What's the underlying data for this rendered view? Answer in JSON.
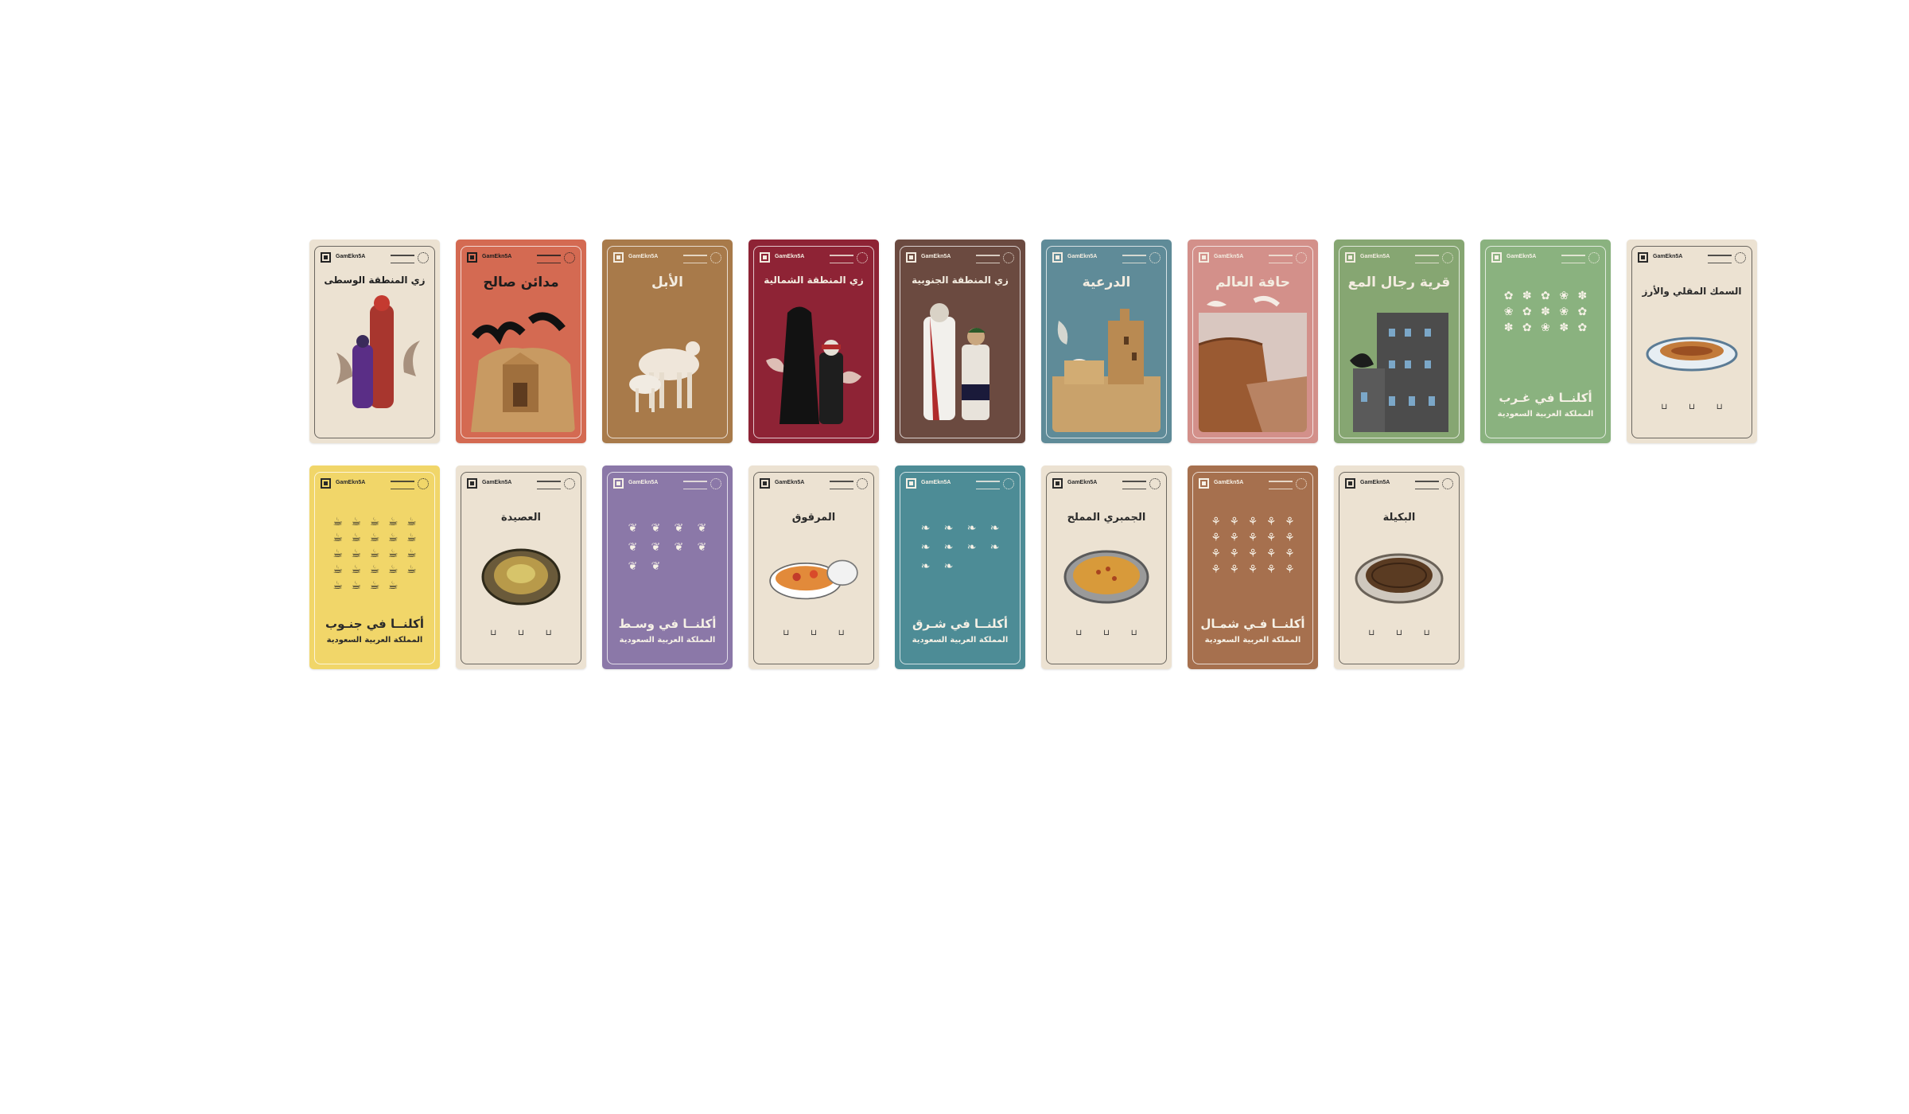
{
  "brand_label": "GamEkn5A",
  "cards": [
    {
      "id": "central-dress",
      "kind": "photo",
      "title": "زي المنطقة الوسطى",
      "bg": "#ece2d2",
      "fg": "#222222",
      "art": "figures-central"
    },
    {
      "id": "madain-saleh",
      "kind": "photo",
      "title": "مدائن صالح",
      "bg": "#d46a52",
      "fg": "#1d1d1d",
      "art": "rock-tomb"
    },
    {
      "id": "camel",
      "kind": "photo",
      "title": "الأبل",
      "bg": "#a87a4a",
      "fg": "#f3ece0",
      "art": "camels"
    },
    {
      "id": "northern-dress",
      "kind": "photo",
      "title": "زي المنطقة الشمالية",
      "bg": "#8e2335",
      "fg": "#f3ece0",
      "art": "figures-north"
    },
    {
      "id": "southern-dress",
      "kind": "photo",
      "title": "زي المنطقة الجنوبية",
      "bg": "#6b4a40",
      "fg": "#f3ece0",
      "art": "figures-south"
    },
    {
      "id": "diriyah",
      "kind": "photo",
      "title": "الدرعية",
      "bg": "#5f8b98",
      "fg": "#f3ece0",
      "art": "mud-ruins"
    },
    {
      "id": "edge-of-world",
      "kind": "photo",
      "title": "حافة العالم",
      "bg": "#d3908a",
      "fg": "#f3ece0",
      "art": "cliff"
    },
    {
      "id": "rijal-almaa",
      "kind": "photo",
      "title": "قرية رجال المع",
      "bg": "#86a672",
      "fg": "#f3ece0",
      "art": "stone-village"
    },
    {
      "id": "west-food",
      "kind": "category",
      "title": "أكلنــا في غـرب",
      "subtitle": "المملكة العربية السعودية",
      "bg": "#8ab27f",
      "fg": "#f6f1e6",
      "icons": [
        "✿",
        "✽",
        "✿",
        "❀",
        "✽",
        "❀",
        "✿",
        "✽",
        "❀",
        "✿",
        "✽",
        "✿",
        "❀",
        "✽",
        "✿"
      ],
      "cols": 5
    },
    {
      "id": "fried-fish-rice",
      "kind": "dish",
      "title": "السمك المقلي والأرز",
      "bg": "#ece2d2",
      "fg": "#2a2a2a",
      "dish": "fish"
    },
    {
      "id": "south-food",
      "kind": "category",
      "title": "أكلنــا في جنـوب",
      "subtitle": "المملكة العربية السعودية",
      "bg": "#f1d669",
      "fg": "#2a2a2a",
      "icons": [
        "☕",
        "☕",
        "☕",
        "☕",
        "☕",
        "☕",
        "☕",
        "☕",
        "☕",
        "☕",
        "☕",
        "☕",
        "☕",
        "☕",
        "☕",
        "☕",
        "☕",
        "☕",
        "☕",
        "☕",
        "☕",
        "☕",
        "☕",
        "☕"
      ],
      "cols": 5
    },
    {
      "id": "asida",
      "kind": "dish",
      "title": "العصيدة",
      "bg": "#ece2d2",
      "fg": "#2a2a2a",
      "dish": "asida"
    },
    {
      "id": "central-food",
      "kind": "category",
      "title": "أكلنــا في وسـط",
      "subtitle": "المملكة العربية السعودية",
      "bg": "#8b78a8",
      "fg": "#f6f1e6",
      "icons": [
        "❦",
        "❦",
        "❦",
        "❦",
        "❦",
        "❦",
        "❦",
        "❦",
        "❦",
        "❦"
      ],
      "cols": 4,
      "ring": true
    },
    {
      "id": "marqooq",
      "kind": "dish",
      "title": "المرقوق",
      "bg": "#ece2d2",
      "fg": "#2a2a2a",
      "dish": "marqooq"
    },
    {
      "id": "east-food",
      "kind": "category",
      "title": "أكلنــا في شـرق",
      "subtitle": "المملكة العربية السعودية",
      "bg": "#4d8c96",
      "fg": "#f6f1e6",
      "icons": [
        "❧",
        "❧",
        "❧",
        "❧",
        "❧",
        "❧",
        "❧",
        "❧",
        "❧",
        "❧"
      ],
      "cols": 4,
      "ring": true
    },
    {
      "id": "jumbri",
      "kind": "dish",
      "title": "الجمبري المملح",
      "bg": "#ece2d2",
      "fg": "#2a2a2a",
      "dish": "jumbri"
    },
    {
      "id": "north-food",
      "kind": "category",
      "title": "أكلنــا فـي شمـال",
      "subtitle": "المملكة العربية السعودية",
      "bg": "#a6704e",
      "fg": "#f6f1e6",
      "icons": [
        "⚘",
        "⚘",
        "⚘",
        "⚘",
        "⚘",
        "⚘",
        "⚘",
        "⚘",
        "⚘",
        "⚘",
        "⚘",
        "⚘",
        "⚘",
        "⚘",
        "⚘",
        "⚘",
        "⚘",
        "⚘",
        "⚘",
        "⚘"
      ],
      "cols": 5
    },
    {
      "id": "bakila",
      "kind": "dish",
      "title": "البكيلة",
      "bg": "#ece2d2",
      "fg": "#2a2a2a",
      "dish": "bakila"
    }
  ]
}
